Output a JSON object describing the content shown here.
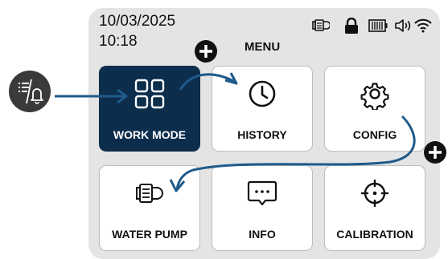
{
  "status_bar": {
    "date": "10/03/2025",
    "time": "10:18",
    "icons": [
      "pump-icon",
      "lock-icon",
      "battery-icon",
      "speaker-icon",
      "wifi-icon"
    ]
  },
  "menu": {
    "title": "MENU",
    "tiles": [
      {
        "label": "WORK MODE",
        "icon": "grid-icon",
        "active": true
      },
      {
        "label": "HISTORY",
        "icon": "clock-icon",
        "active": false
      },
      {
        "label": "CONFIG",
        "icon": "gear-icon",
        "active": false
      },
      {
        "label": "WATER PUMP",
        "icon": "pump-icon",
        "active": false
      },
      {
        "label": "INFO",
        "icon": "chat-icon",
        "active": false
      },
      {
        "label": "CALIBRATION",
        "icon": "crosshair-icon",
        "active": false
      }
    ]
  },
  "external": {
    "icon": "list-bell-icon"
  },
  "annotations": {
    "plus_icons": [
      "plus-icon",
      "plus-icon"
    ]
  },
  "colors": {
    "active_tile": "#0d2d4d",
    "screen_bg": "#e4e4e4",
    "arrow": "#1f5a8a"
  }
}
